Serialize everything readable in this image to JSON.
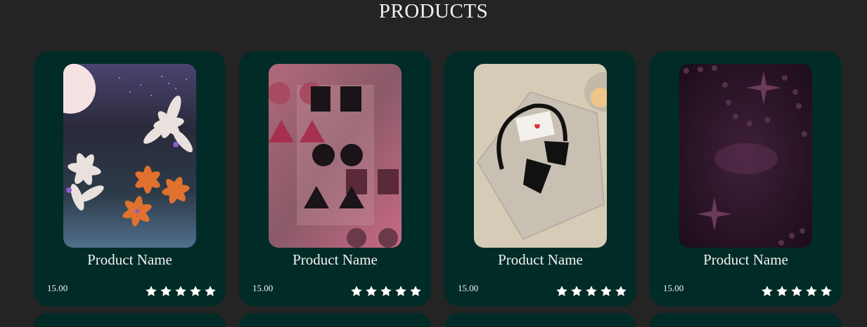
{
  "page": {
    "title": "PRODUCTS"
  },
  "products": [
    {
      "name": "Product Name",
      "price": "15.00",
      "rating": 5,
      "image": "lilies-night-art"
    },
    {
      "name": "Product Name",
      "price": "15.00",
      "rating": 5,
      "image": "geometric-shapes-art"
    },
    {
      "name": "Product Name",
      "price": "15.00",
      "rating": 5,
      "image": "headphones-letter-art"
    },
    {
      "name": "Product Name",
      "price": "15.00",
      "rating": 5,
      "image": "starry-purple-art"
    }
  ],
  "icons": {
    "rating": "star-icon"
  },
  "colors": {
    "background": "#242424",
    "card": "#012b27",
    "text": "#f3f3f3",
    "star": "#ffffff"
  }
}
